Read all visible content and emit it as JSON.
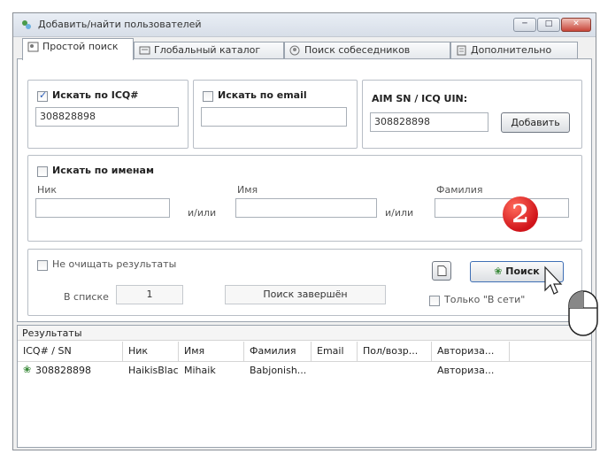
{
  "window": {
    "title": "Добавить/найти пользователей"
  },
  "tabs": [
    {
      "label": "Простой поиск"
    },
    {
      "label": "Глобальный каталог"
    },
    {
      "label": "Поиск собеседников"
    },
    {
      "label": "Дополнительно"
    }
  ],
  "icq_group": {
    "label": "Искать по ICQ#",
    "checked": true,
    "value": "308828898"
  },
  "email_group": {
    "label": "Искать по email",
    "value": ""
  },
  "aim_group": {
    "label": "AIM SN / ICQ UIN:",
    "value": "308828898",
    "add_button": "Добавить"
  },
  "names_group": {
    "label": "Искать по именам",
    "nick_label": "Ник",
    "first_label": "Имя",
    "last_label": "Фамилия",
    "or1": "и/или",
    "or2": "и/или"
  },
  "options": {
    "dont_clear": "Не очищать результаты",
    "in_list_label": "В списке",
    "in_list_value": "1",
    "status": "Поиск завершён",
    "search_button": "Поиск",
    "online_only": "Только \"В сети\""
  },
  "badge": "2",
  "results": {
    "title": "Результаты",
    "columns": [
      "ICQ# / SN",
      "Ник",
      "Имя",
      "Фамилия",
      "Email",
      "Пол/возр...",
      "Авториза..."
    ],
    "rows": [
      [
        "308828898",
        "HaikisBlack",
        "Mihaik",
        "Babjonish...",
        "",
        "",
        "Авториза..."
      ]
    ]
  },
  "colors": {
    "badge": "#d0141a",
    "accent": "#2b5db8"
  }
}
